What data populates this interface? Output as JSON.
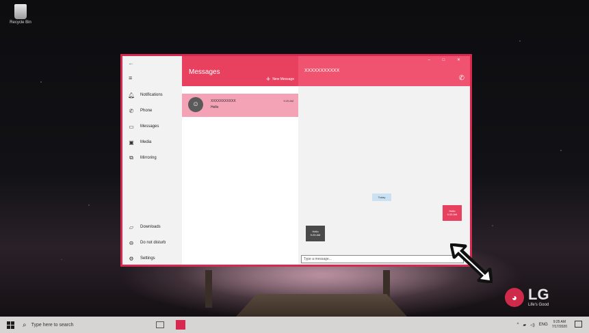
{
  "desktop": {
    "recycle_bin_label": "Recycle Bin",
    "brand": "LG",
    "brand_slogan": "Life's Good"
  },
  "app": {
    "nav": {
      "top_items": [
        {
          "icon": "bell-icon",
          "label": "Notifications"
        },
        {
          "icon": "phone-icon",
          "label": "Phone"
        },
        {
          "icon": "chat-icon",
          "label": "Messages"
        },
        {
          "icon": "media-icon",
          "label": "Media"
        },
        {
          "icon": "mirroring-icon",
          "label": "Mirroring"
        }
      ],
      "bottom_items": [
        {
          "icon": "folder-icon",
          "label": "Downloads"
        },
        {
          "icon": "do-not-disturb-icon",
          "label": "Do not disturb"
        },
        {
          "icon": "gear-icon",
          "label": "Settings"
        }
      ]
    },
    "messages_panel": {
      "title": "Messages",
      "new_message_label": "New Message",
      "conversations": [
        {
          "name": "XXXXXXXXXXX",
          "preview": "Hello",
          "time": "9:25 AM"
        }
      ]
    },
    "chat": {
      "contact": "XXXXXXXXXXX",
      "day_label": "Today",
      "outgoing": {
        "text": "Hello",
        "time": "9:25 AM"
      },
      "incoming": {
        "text": "Hello",
        "time": "9:25 AM"
      },
      "composer_placeholder": "Type a message..."
    },
    "accent_color": "#e8405f"
  },
  "taskbar": {
    "search_placeholder": "Type here to search",
    "language": "ENG",
    "time": "9:25 AM",
    "date": "7/17/2020"
  }
}
